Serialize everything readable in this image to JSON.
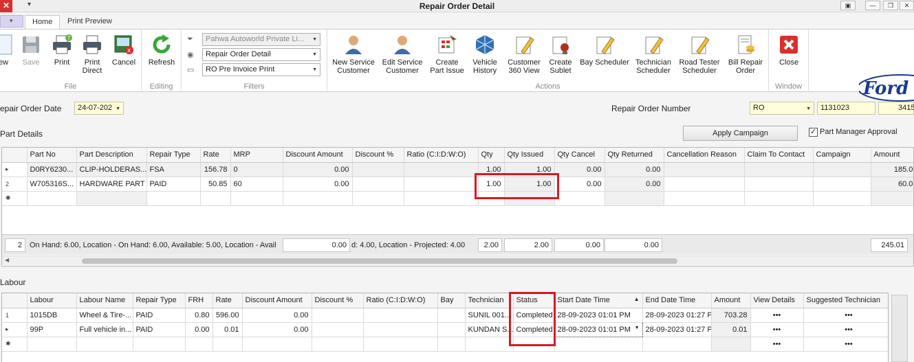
{
  "window": {
    "title": "Repair Order Detail"
  },
  "tabs": [
    {
      "label": "Home",
      "active": true
    },
    {
      "label": "Print Preview",
      "active": false
    }
  ],
  "ribbon": {
    "groups": {
      "file": "File",
      "editing": "Editing",
      "filters": "Filters",
      "actions": "Actions",
      "window": "Window"
    },
    "buttons": {
      "new": "ew",
      "save": "Save",
      "print": "Print",
      "print_direct": [
        "Print",
        "Direct"
      ],
      "cancel": "Cancel",
      "refresh": "Refresh",
      "new_service_customer": [
        "New Service",
        "Customer"
      ],
      "edit_service_customer": [
        "Edit Service",
        "Customer"
      ],
      "create_part_issue": [
        "Create",
        "Part Issue"
      ],
      "vehicle_history": [
        "Vehicle",
        "History"
      ],
      "customer_360": [
        "Customer",
        "360 View"
      ],
      "create_sublet": [
        "Create",
        "Sublet"
      ],
      "bay_scheduler": "Bay Scheduler",
      "technician_scheduler": [
        "Technician",
        "Scheduler"
      ],
      "road_tester_scheduler": [
        "Road Tester",
        "Scheduler"
      ],
      "bill_repair_order": [
        "Bill Repair",
        "Order"
      ],
      "close": "Close"
    },
    "filters": {
      "dealer": "Pahwa Autoworld Private Li...",
      "view": "Repair Order Detail",
      "print_format": "RO Pre Invoice Print"
    },
    "brand": "Ford"
  },
  "header": {
    "ro_date_label": "epair Order Date",
    "ro_date_value": "24-07-202",
    "ro_number_label": "Repair Order Number",
    "ro_prefix": "RO",
    "ro_number": "1131023",
    "ro_suffix": "3415"
  },
  "parts": {
    "section_title": "Part Details",
    "apply_campaign": "Apply Campaign",
    "approval_label": "Part Manager Approval",
    "approval_checked": true,
    "columns": [
      "",
      "Part No",
      "Part Description",
      "Repair Type",
      "Rate",
      "MRP",
      "Discount Amount",
      "Discount %",
      "Ratio (C:I:D:W:O)",
      "Qty",
      "Qty Issued",
      "Qty Cancel",
      "Qty Returned",
      "Cancellation Reason",
      "Claim To Contact",
      "Campaign",
      "Amount"
    ],
    "rows": [
      {
        "ind": "▸",
        "part_no": "D0RY6230...",
        "desc": "CLIP-HOLDERAS...",
        "repair_type": "FSA",
        "rate": "156.78",
        "mrp": "0",
        "disc_amt": "0.00",
        "disc_pct": "",
        "ratio": "",
        "qty": "1.00",
        "qty_issued": "1.00",
        "qty_cancel": "0.00",
        "qty_returned": "0.00",
        "reason": "",
        "claim": "",
        "campaign": "",
        "amount": "185.00"
      },
      {
        "ind": "2",
        "part_no": "W705316S...",
        "desc": "HARDWARE PART",
        "repair_type": "PAID",
        "rate": "50.85",
        "mrp": "60",
        "disc_amt": "0.00",
        "disc_pct": "",
        "ratio": "",
        "qty": "1.00",
        "qty_issued": "1.00",
        "qty_cancel": "0.00",
        "qty_returned": "0.00",
        "reason": "",
        "claim": "",
        "campaign": "",
        "amount": "60.01"
      }
    ],
    "new_row_ind": "✱",
    "footer": {
      "count": "2",
      "info_left": "On Hand:  6.00, Location - On Hand:  6.00, Available:  5.00, Location - Avail",
      "disc_total": "0.00",
      "info_right": "d:  4.00, Location - Projected:  4.00",
      "qty_total": "2.00",
      "qty_issued_total": "2.00",
      "qty_cancel_total": "0.00",
      "qty_returned_total": "0.00",
      "amount_total": "245.01"
    }
  },
  "labour": {
    "section_title": "Labour",
    "columns": [
      "",
      "Labour",
      "Labour Name",
      "Repair Type",
      "FRH",
      "Rate",
      "Discount Amount",
      "Discount %",
      "Ratio (C:I:D:W:O)",
      "Bay",
      "Technician",
      "Status",
      "Start Date Time",
      "End Date Time",
      "Amount",
      "View Details",
      "Suggested Technician"
    ],
    "rows": [
      {
        "ind": "1",
        "code": "1015DB",
        "name": "Wheel & Tire-...",
        "repair_type": "PAID",
        "frh": "0.80",
        "rate": "596.00",
        "disc_amt": "0.00",
        "disc_pct": "",
        "ratio": "",
        "bay": "",
        "technician": "SUNIL  001...",
        "status": "Completed",
        "start": "28-09-2023 01:01 PM",
        "end": "28-09-2023 01:27 P",
        "amount": "703.28",
        "view": "•••",
        "suggested": "•••"
      },
      {
        "ind": "▸",
        "code": "99P",
        "name": "Full vehicle in...",
        "repair_type": "PAID",
        "frh": "0.00",
        "rate": "0.01",
        "disc_amt": "0.00",
        "disc_pct": "",
        "ratio": "",
        "bay": "",
        "technician": "KUNDAN  S...",
        "status": "Completed",
        "start": "28-09-2023 01:01 PM",
        "end": "28-09-2023 01:27 P",
        "amount": "0.01",
        "view": "•••",
        "suggested": "•••"
      }
    ],
    "new_row_ind": "✱",
    "new_row_view": "•••",
    "new_row_suggested": "•••"
  },
  "colors": {
    "highlight": "#d71920",
    "field_bg": "#fffcd9",
    "brand_blue": "#1a3a8c"
  }
}
